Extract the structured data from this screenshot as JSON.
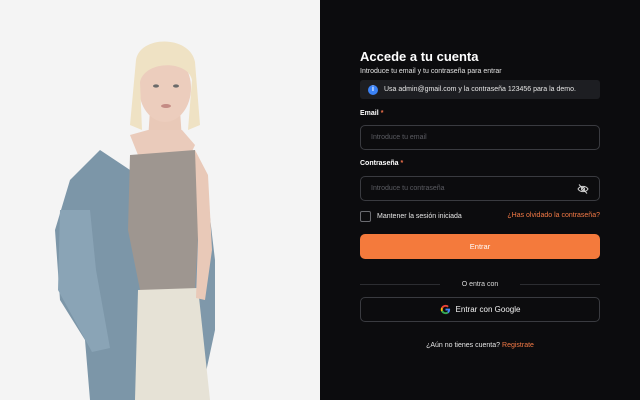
{
  "hero": {
    "image": "woman-in-denim-jacket-photo"
  },
  "login": {
    "title": "Accede a tu cuenta",
    "subtitle": "Introduce tu email y tu contraseña para entrar",
    "notice": {
      "icon": "info-icon",
      "text": "Usa admin@gmail.com y la contraseña 123456 para la demo."
    },
    "email": {
      "label": "Email",
      "required_mark": "*",
      "placeholder": "Introduce tu email"
    },
    "password": {
      "label": "Contraseña",
      "required_mark": "*",
      "placeholder": "Introduce tu contraseña",
      "toggle_icon": "eye-off-icon"
    },
    "remember_label": "Mantener la sesión iniciada",
    "remember_checked": false,
    "forgot_link": "¿Has olvidado la contraseña?",
    "submit_label": "Entrar",
    "divider_text": "O entra con",
    "google_label": "Entrar con Google",
    "signup_prompt": "¿Aún no tienes cuenta?",
    "signup_link": "Registrate"
  },
  "colors": {
    "accent": "#f47a3c",
    "background": "#0c0c0e",
    "info": "#3b82f6"
  }
}
